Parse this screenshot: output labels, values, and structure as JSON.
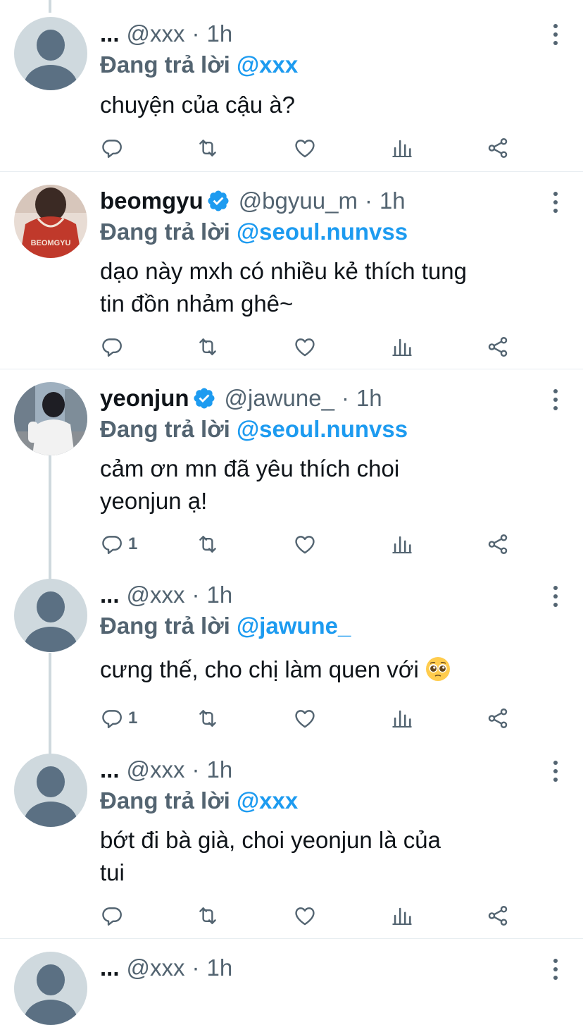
{
  "tweets": [
    {
      "name": "...",
      "handle": "@xxx",
      "separator": "·",
      "time": "1h",
      "replying_prefix": "Đang trả lời",
      "replying_to": "@xxx",
      "text": "chuyện của cậu à?",
      "reply_count": "",
      "avatar_icon": "default-avatar-icon"
    },
    {
      "name": "beomgyu",
      "verified": true,
      "handle": "@bgyuu_m",
      "separator": "·",
      "time": "1h",
      "replying_prefix": "Đang trả lời",
      "replying_to": "@seoul.nunvss",
      "text_line1": "dạo này mxh có nhiều kẻ thích tung",
      "text_line2": "tin đồn nhảm ghê~",
      "reply_count": "",
      "jersey_text": "BEOMGYU"
    },
    {
      "name": "yeonjun",
      "verified": true,
      "handle": "@jawune_",
      "separator": "·",
      "time": "1h",
      "replying_prefix": "Đang trả lời",
      "replying_to": "@seoul.nunvss",
      "text_line1": "cảm ơn mn đã yêu thích choi",
      "text_line2": "yeonjun ạ!",
      "reply_count": "1"
    },
    {
      "name": "...",
      "handle": "@xxx",
      "separator": "·",
      "time": "1h",
      "replying_prefix": "Đang trả lời",
      "replying_to": "@jawune_",
      "text": "cưng thế, cho chị làm quen với",
      "emoji": "pleading-face-emoji",
      "reply_count": "1"
    },
    {
      "name": "...",
      "handle": "@xxx",
      "separator": "·",
      "time": "1h",
      "replying_prefix": "Đang trả lời",
      "replying_to": "@xxx",
      "text_line1": "bớt đi bà già, choi yeonjun là của",
      "text_line2": "tui",
      "reply_count": ""
    },
    {
      "name": "...",
      "handle": "@xxx",
      "separator": "·",
      "time": "1h"
    }
  ],
  "colors": {
    "accent": "#1d9bf0",
    "secondary_text": "#536471",
    "primary_text": "#0f1419",
    "divider": "#e6ecf0",
    "thread_line": "#cfd9de"
  },
  "icons": [
    "reply-icon",
    "retweet-icon",
    "like-icon",
    "views-icon",
    "share-icon",
    "more-options-icon",
    "verified-badge-icon"
  ]
}
